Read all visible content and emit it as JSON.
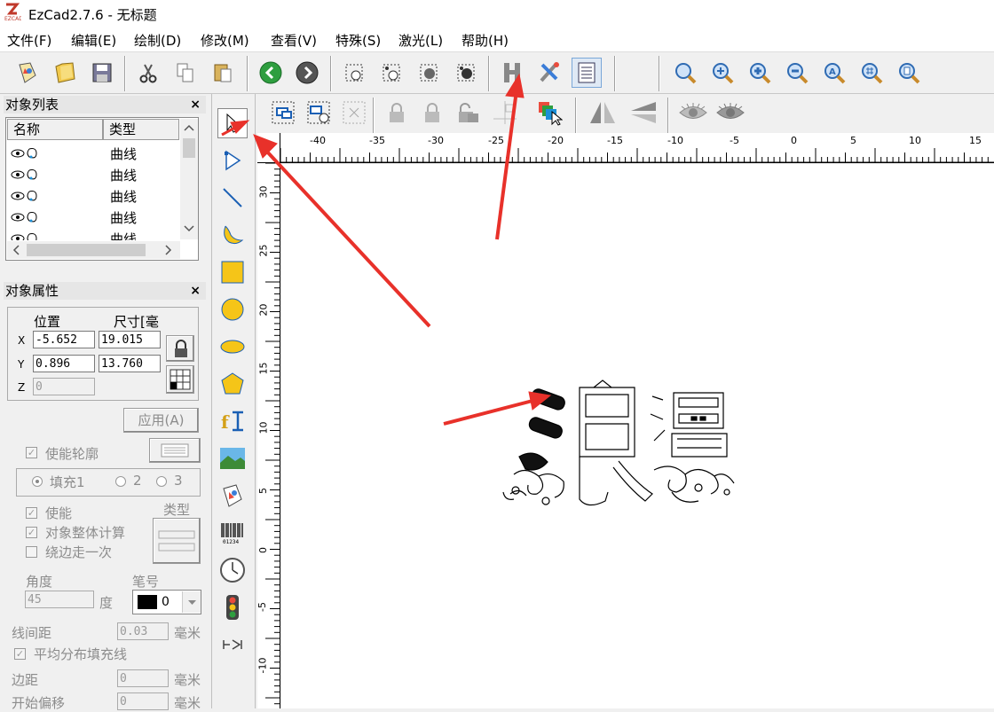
{
  "window": {
    "title": "EzCad2.7.6 - 无标题"
  },
  "menu": [
    "文件(F)",
    "编辑(E)",
    "绘制(D)",
    "修改(M)",
    "查看(V)",
    "特殊(S)",
    "激光(L)",
    "帮助(H)"
  ],
  "toolbar_icons": [
    "new-file-icon",
    "open-folder-icon",
    "save-icon",
    "cut-icon",
    "copy-icon",
    "paste-icon",
    "back-arrow-icon",
    "forward-arrow-icon",
    "node-group-icon",
    "node-ungroup-icon",
    "node-select-icon",
    "node-edit-icon",
    "hatch-icon",
    "tools-icon",
    "list-icon",
    "zoom-icon",
    "zoom-in-icon",
    "zoom-plus-icon",
    "zoom-minus-icon",
    "zoom-a-icon",
    "zoom-grid-icon",
    "zoom-page-icon"
  ],
  "object_list": {
    "title": "对象列表",
    "close": "×",
    "columns": [
      "名称",
      "类型"
    ],
    "rows": [
      {
        "type": "曲线"
      },
      {
        "type": "曲线"
      },
      {
        "type": "曲线"
      },
      {
        "type": "曲线"
      },
      {
        "type": "曲线"
      }
    ]
  },
  "object_properties": {
    "title": "对象属性",
    "close": "×",
    "pos_header": "位置",
    "size_header": "尺寸[毫",
    "x_label": "X",
    "y_label": "Y",
    "z_label": "Z",
    "x_pos": "-5.652",
    "x_size": "19.015",
    "y_pos": "0.896",
    "y_size": "13.760",
    "z_pos": "0",
    "apply_label": "应用(A)",
    "enable_outline": "使能轮廓",
    "fill_tabs": [
      "填充1",
      "2",
      "3"
    ],
    "enable": "使能",
    "whole_calc": "对象整体计算",
    "edge_once": "绕边走一次",
    "type_label": "类型",
    "angle_label": "角度",
    "angle_value": "45",
    "degree": "度",
    "pen_label": "笔号",
    "pen_value": "0",
    "line_spacing_label": "线间距",
    "line_spacing_value": "0.03",
    "mm": "毫米",
    "avg_fill": "平均分布填充线",
    "margin_label": "边距",
    "margin_value": "0",
    "start_offset_label": "开始偏移",
    "start_offset_value": "0"
  },
  "ruler": {
    "top_labels": [
      "-40",
      "-35",
      "-30",
      "-25",
      "-20",
      "-15",
      "-10",
      "-5",
      "0",
      "5",
      "10",
      "15"
    ],
    "left_labels": [
      "30",
      "25",
      "20",
      "15",
      "10",
      "5",
      "0",
      "-5",
      "-10"
    ]
  },
  "colors": {
    "accent_red": "#e8312a",
    "selection_blue": "#0066cc"
  }
}
